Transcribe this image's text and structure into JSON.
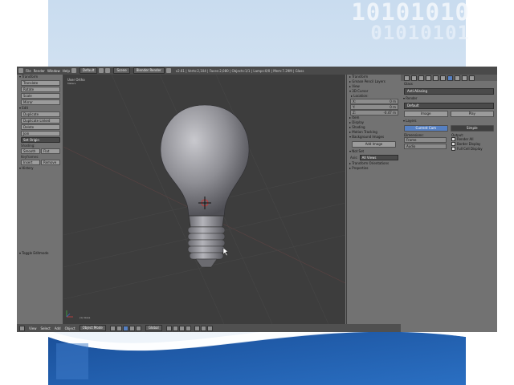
{
  "background": {
    "binary_line1": "10101010",
    "binary_line2": "01010101",
    "wave_color": "#1b5aa8",
    "sky_color": "#d8e6f4"
  },
  "colors": {
    "accent": "#5680c2",
    "viewport": "#3d3d3d",
    "panel": "#727272",
    "header": "#4a4a4a"
  },
  "app": {
    "topbar": {
      "menus": [
        "File",
        "Render",
        "Window",
        "Help"
      ],
      "screen_layout": "Default",
      "scene": "Scene",
      "render_engine": "Blender Render",
      "stats": "v2.61 | Verts:2,104 | Faces:2,080 | Objects:1/1 | Lamps:0/0 | Mem:7.29M | Glass"
    },
    "toolshelf": {
      "transform_header": "Transform",
      "transform_buttons": [
        "Translate",
        "Rotate",
        "Scale",
        "Mirror"
      ],
      "edit_header": "Edit",
      "edit_buttons": [
        "Duplicate",
        "Duplicate Linked",
        "Delete",
        "Join"
      ],
      "set_origin": "Set Origin",
      "shading_label": "Shading:",
      "shading_buttons": [
        "Smooth",
        "Flat"
      ],
      "keyframes_label": "Keyframes:",
      "keyframe_buttons": [
        "Insert",
        "Remove"
      ],
      "history_header": "History",
      "toggle_editmode": "Toggle Editmode"
    },
    "viewport": {
      "view_label": "User Ortho",
      "unit_label": "Meters",
      "object_label": "(1) Glass"
    },
    "npanel": {
      "transform": "Transform",
      "grease_pencil": "Grease Pencil Layers",
      "view": "View",
      "3d_cursor": "3D Cursor",
      "location_label": "Location:",
      "cursor_x_label": "X:",
      "cursor_x": "0 m",
      "cursor_y_label": "Y:",
      "cursor_y": "0 m",
      "cursor_z_label": "Z:",
      "cursor_z": "-0.47 m",
      "item": "Item",
      "display": "Display",
      "shading": "Shading",
      "motion_tracking": "Motion Tracking",
      "background_images": "Background Images",
      "add_image": "Add Image",
      "image_toggle": "Not Set",
      "axis_label": "Axis:",
      "axis_value": "All Views",
      "transform_orientations": "Transform Orientations",
      "properties": "Properties"
    },
    "props": {
      "path": "Glass",
      "world_dd": "Anti-Aliasing",
      "render_header": "Render",
      "render_preset": "Default",
      "render_buttons": [
        "Image",
        "Play"
      ],
      "layers_header": "Layers",
      "display_buttons": [
        "Current Cam",
        "Simple"
      ],
      "dimensions_label": "Dimensions:",
      "dimensions": [
        "Frame",
        "Audio"
      ],
      "output_label": "Output:",
      "options": [
        "Render All",
        "Border Display",
        "Full Cell Display"
      ]
    },
    "bottombar": {
      "items": [
        "View",
        "Select",
        "Add",
        "Object"
      ],
      "mode": "Object Mode",
      "orientation": "Global"
    }
  }
}
